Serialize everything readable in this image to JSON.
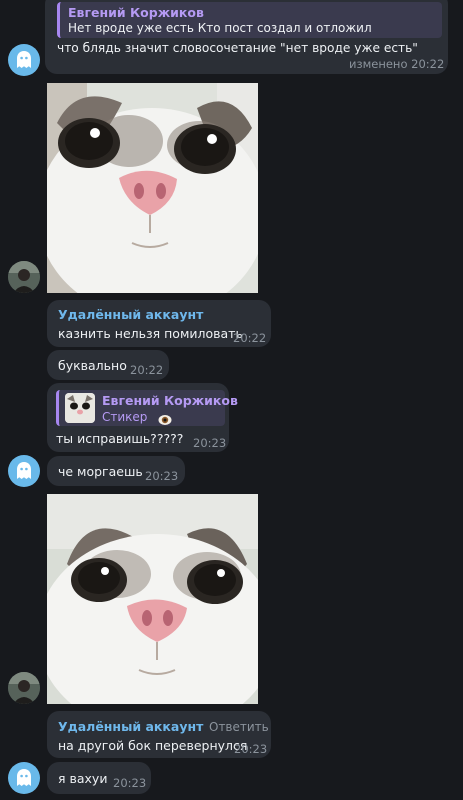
{
  "msg1": {
    "quote_name": "Евгений Коржиков",
    "quote_text": "Нет вроде уже есть Кто пост создал и отложил",
    "text": "что блядь значит словосочетание \"нет вроде уже есть\"",
    "meta": "изменено 20:22"
  },
  "msg2": {
    "sender": "Удалённый аккаунт",
    "text": "казнить нельзя помиловать",
    "time": "20:22"
  },
  "msg3": {
    "text": "буквально",
    "time": "20:22"
  },
  "msg4": {
    "quote_name": "Евгений Коржиков",
    "quote_text": "Стикер",
    "text": "ты исправишь?????",
    "time": "20:23"
  },
  "msg5": {
    "text": "че моргаешь",
    "time": "20:23"
  },
  "msg6": {
    "sender": "Удалённый аккаунт",
    "reply_label": "Ответить",
    "text": "на другой бок перевернулся",
    "time": "20:23"
  },
  "msg7": {
    "text": "я вахуи",
    "time": "20:23"
  },
  "colors": {
    "background": "#17191d",
    "bubble": "#2b2f36",
    "sender_blue": "#6fb8ec",
    "quote_purple": "#b59af3",
    "ghost_avatar": "#69b9ea"
  },
  "icons": [
    "ghost-avatar-icon",
    "user-photo-avatar",
    "eye-emoji-icon"
  ]
}
